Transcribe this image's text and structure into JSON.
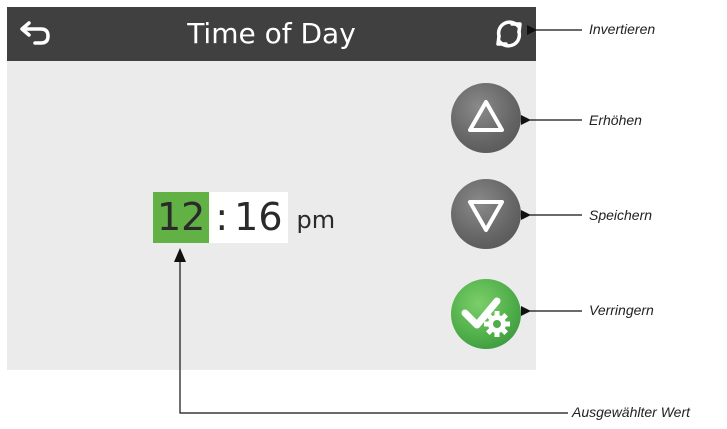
{
  "header": {
    "title": "Time of Day",
    "back_icon": "back-arrow-icon",
    "invert_icon": "refresh-icon"
  },
  "time": {
    "hour": "12",
    "separator": ":",
    "minute": "16",
    "ampm": "pm",
    "selected": "hour"
  },
  "buttons": {
    "up_icon": "triangle-up-icon",
    "down_icon": "triangle-down-icon",
    "save_icon": "check-gear-icon"
  },
  "callouts": {
    "invert": "Invertieren",
    "up": "Erhöhen",
    "down": "Speichern",
    "save": "Verringern",
    "selected_value": "Ausgewählter Wert"
  },
  "colors": {
    "titlebar": "#404040",
    "screen": "#ebebeb",
    "selected": "#62b145",
    "button_gray": "#666666",
    "button_green": "#4fae49"
  }
}
